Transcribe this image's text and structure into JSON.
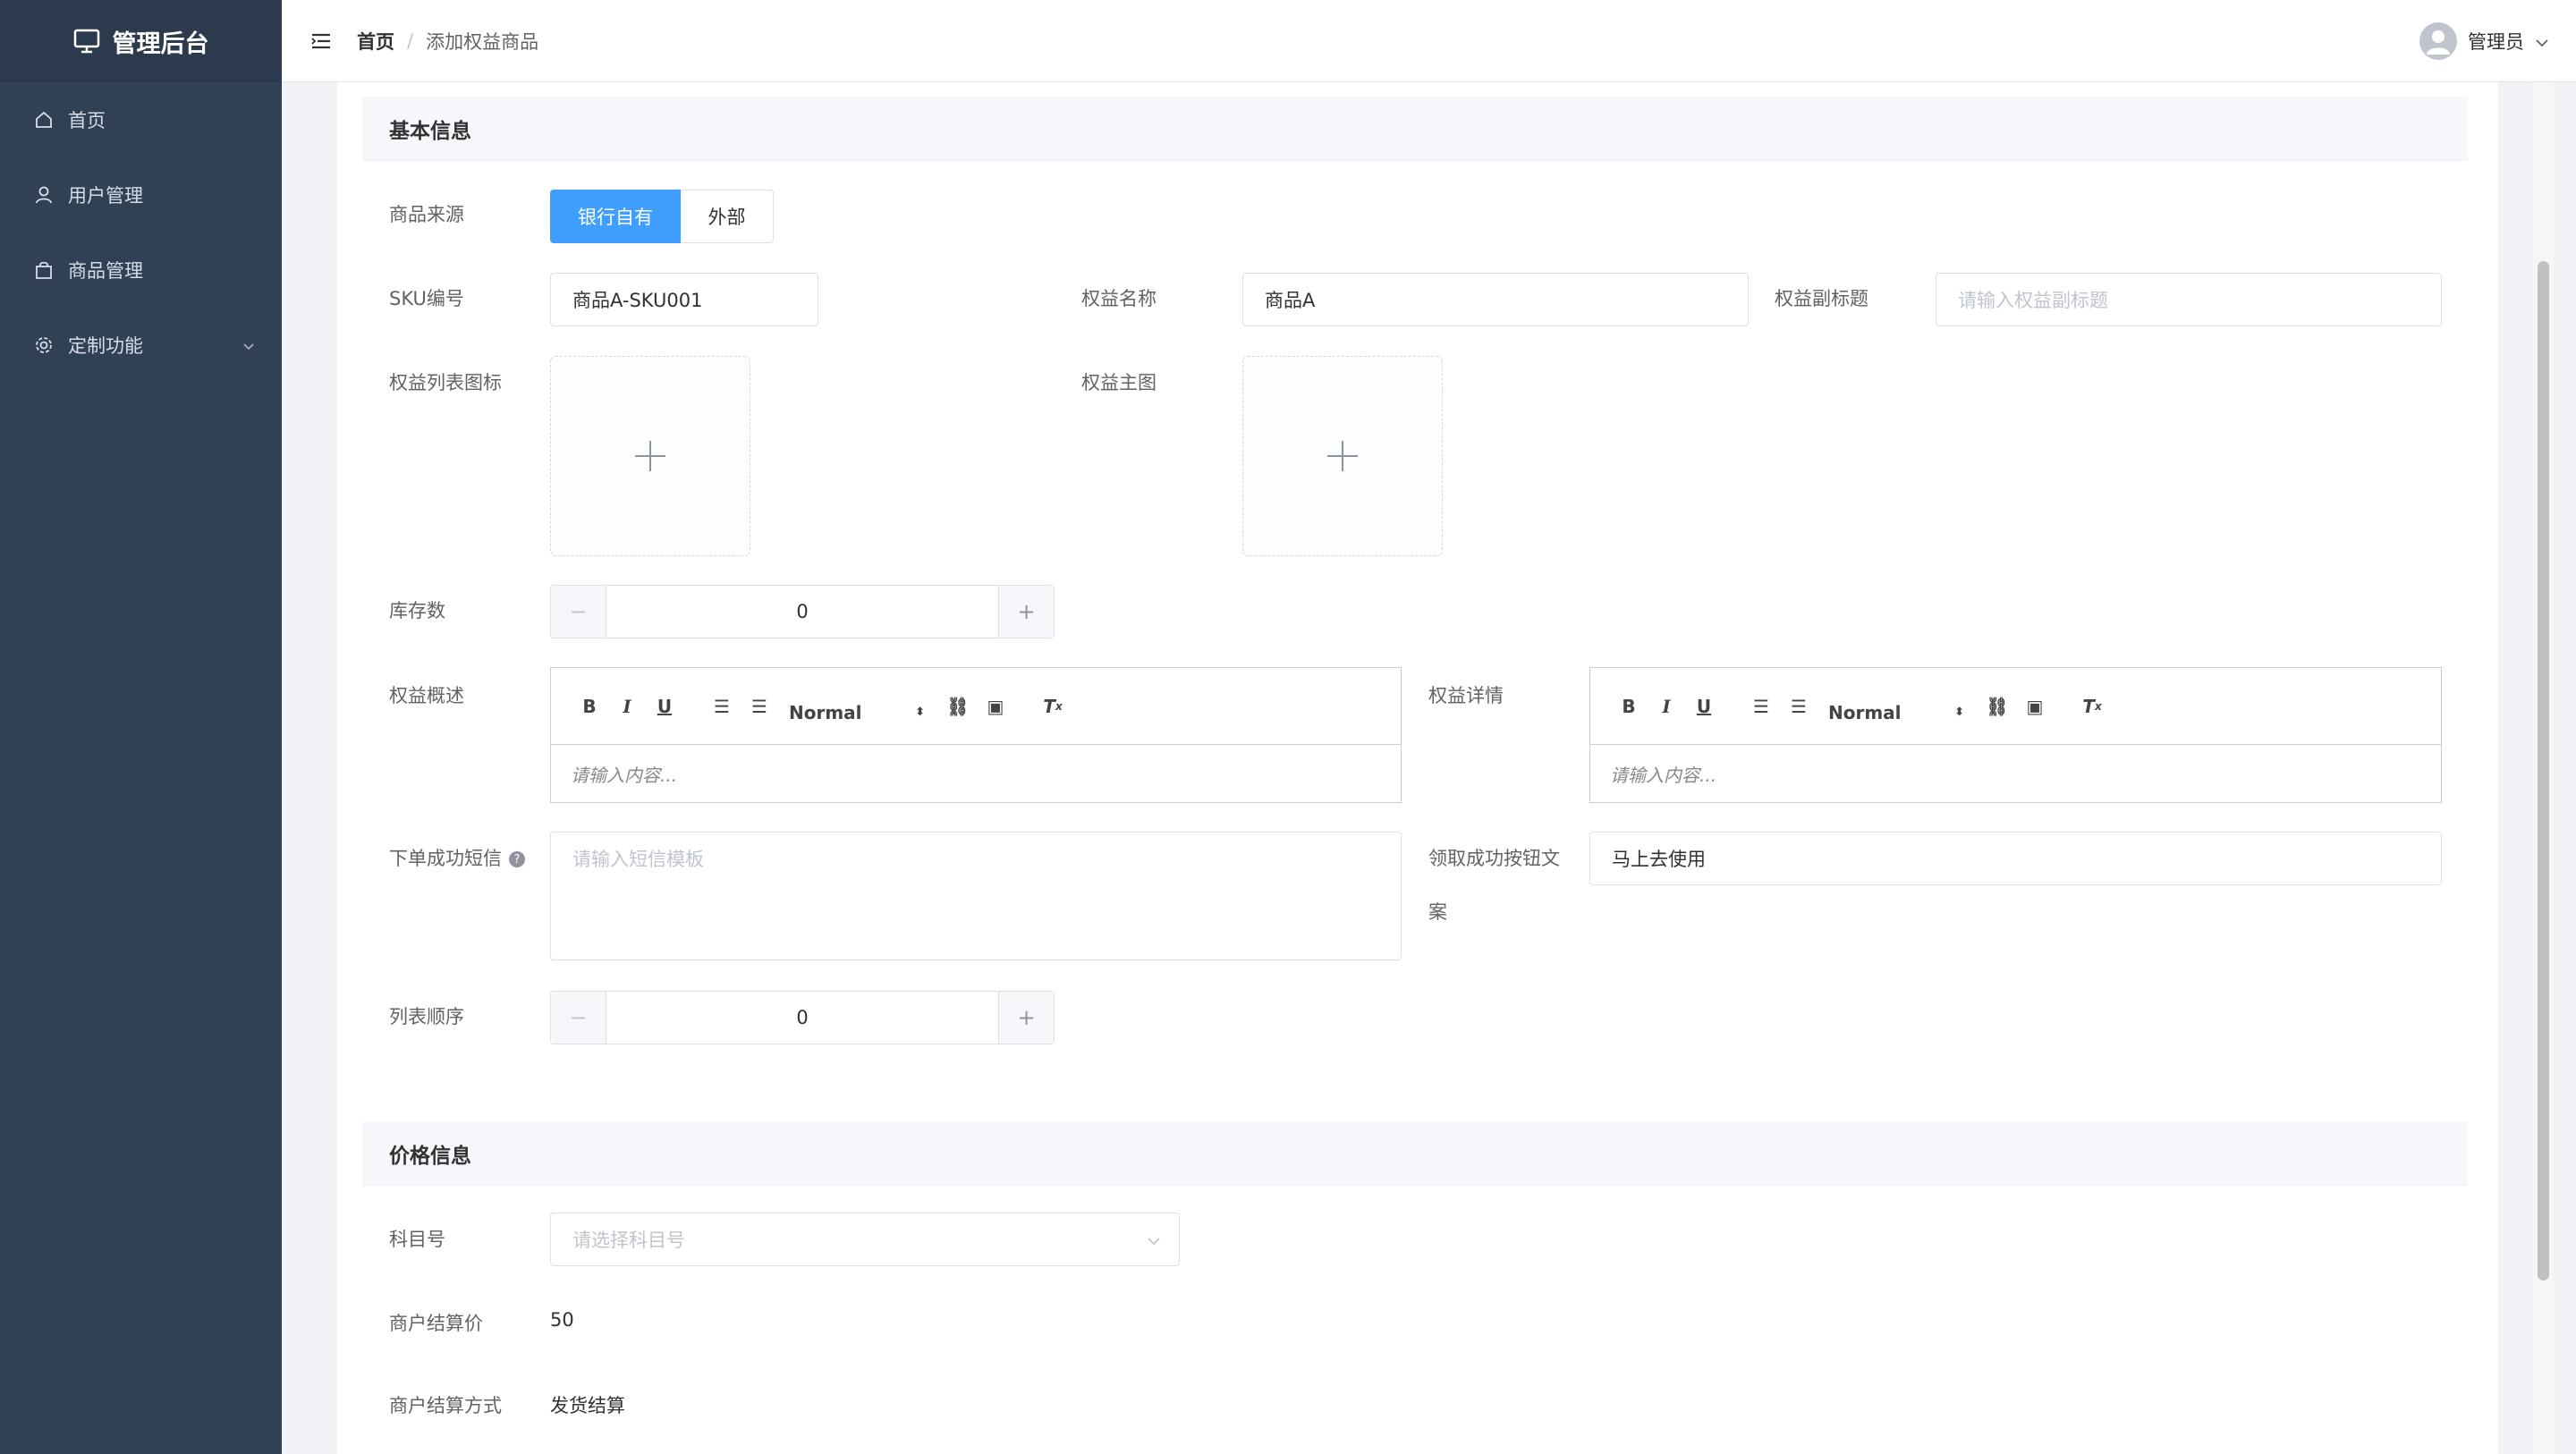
{
  "app": {
    "title": "管理后台"
  },
  "sidebar": {
    "items": [
      {
        "label": "首页",
        "icon": "home-icon"
      },
      {
        "label": "用户管理",
        "icon": "user-icon"
      },
      {
        "label": "商品管理",
        "icon": "bag-icon"
      },
      {
        "label": "定制功能",
        "icon": "gear-icon"
      }
    ]
  },
  "breadcrumb": {
    "home": "首页",
    "sep": "/",
    "current": "添加权益商品"
  },
  "user": {
    "name": "管理员"
  },
  "basic": {
    "title": "基本信息",
    "source_label": "商品来源",
    "source_options": [
      "银行自有",
      "外部"
    ],
    "sku_label": "SKU编号",
    "sku_value": "商品A-SKU001",
    "name_label": "权益名称",
    "name_value": "商品A",
    "subtitle_label": "权益副标题",
    "subtitle_placeholder": "请输入权益副标题",
    "list_icon_label": "权益列表图标",
    "main_image_label": "权益主图",
    "stock_label": "库存数",
    "stock_value": "0",
    "summary_label": "权益概述",
    "detail_label": "权益详情",
    "editor_placeholder": "请输入内容...",
    "editor_format": "Normal",
    "sms_label": "下单成功短信",
    "sms_placeholder": "请输入短信模板",
    "button_text_label_1": "领取成功按钮文",
    "button_text_label_2": "案",
    "button_text_value": "马上去使用",
    "order_label": "列表顺序",
    "order_value": "0"
  },
  "price": {
    "title": "价格信息",
    "subject_label": "科目号",
    "subject_placeholder": "请选择科目号",
    "settle_price_label": "商户结算价",
    "settle_price_value": "50",
    "settle_method_label": "商户结算方式",
    "settle_method_value": "发货结算"
  },
  "colors": {
    "sidebar": "#304156",
    "primary": "#409eff"
  }
}
